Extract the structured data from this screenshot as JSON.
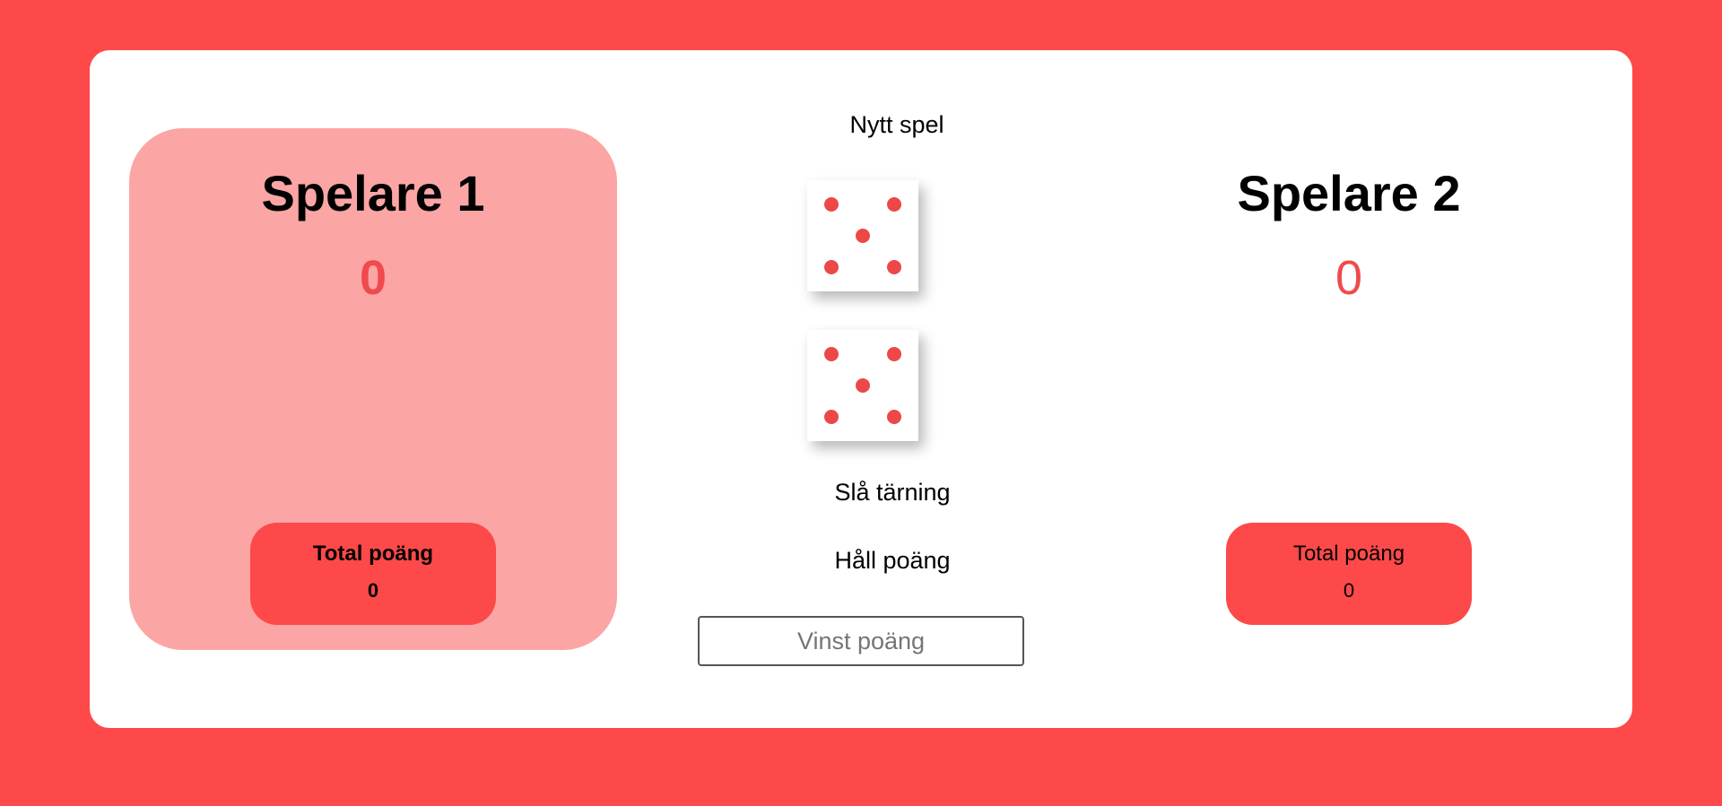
{
  "game": {
    "new_game_label": "Nytt spel",
    "roll_label": "Slå tärning",
    "hold_label": "Håll poäng",
    "win_placeholder": "Vinst poäng",
    "win_value": ""
  },
  "players": [
    {
      "name": "Spelare 1",
      "current_score": "0",
      "total_label": "Total poäng",
      "total_score": "0",
      "active": true
    },
    {
      "name": "Spelare 2",
      "current_score": "0",
      "total_label": "Total poäng",
      "total_score": "0",
      "active": false
    }
  ],
  "dice": [
    {
      "value": 5
    },
    {
      "value": 5
    }
  ],
  "colors": {
    "background": "#fd4949",
    "active_panel": "#fca5a5",
    "accent": "#f04a4d",
    "pip": "#ec4848"
  }
}
